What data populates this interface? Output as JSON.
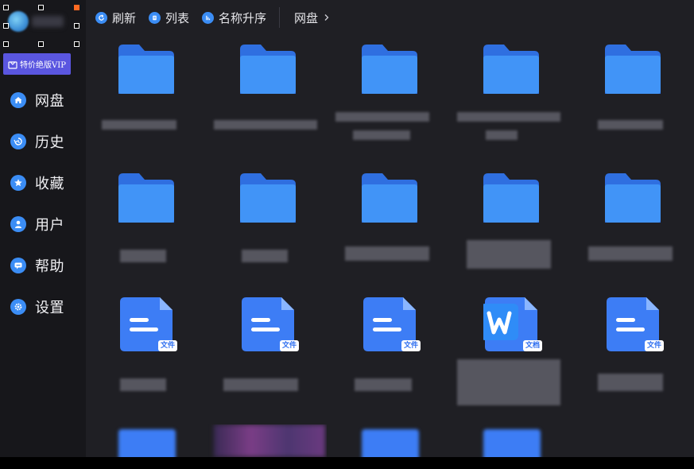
{
  "sidebar": {
    "vip_label": "特价绝版VIP",
    "items": [
      {
        "label": "网盘",
        "icon": "home-icon"
      },
      {
        "label": "历史",
        "icon": "history-icon"
      },
      {
        "label": "收藏",
        "icon": "star-icon"
      },
      {
        "label": "用户",
        "icon": "user-icon"
      },
      {
        "label": "帮助",
        "icon": "help-icon"
      },
      {
        "label": "设置",
        "icon": "gear-icon"
      }
    ]
  },
  "toolbar": {
    "refresh_label": "刷新",
    "list_label": "列表",
    "sort_label": "名称升序",
    "breadcrumb_label": "网盘"
  },
  "files": {
    "doc_badge": "文件",
    "word_badge": "文档",
    "word_glyph": "W"
  },
  "colors": {
    "accent": "#3b8df5",
    "folder": "#4194f7",
    "folder_tab": "#2f6fe0",
    "doc": "#3d7df5",
    "vip": "#5a56e0",
    "sidebar_bg": "#17171b",
    "main_bg": "#1f1f24"
  }
}
